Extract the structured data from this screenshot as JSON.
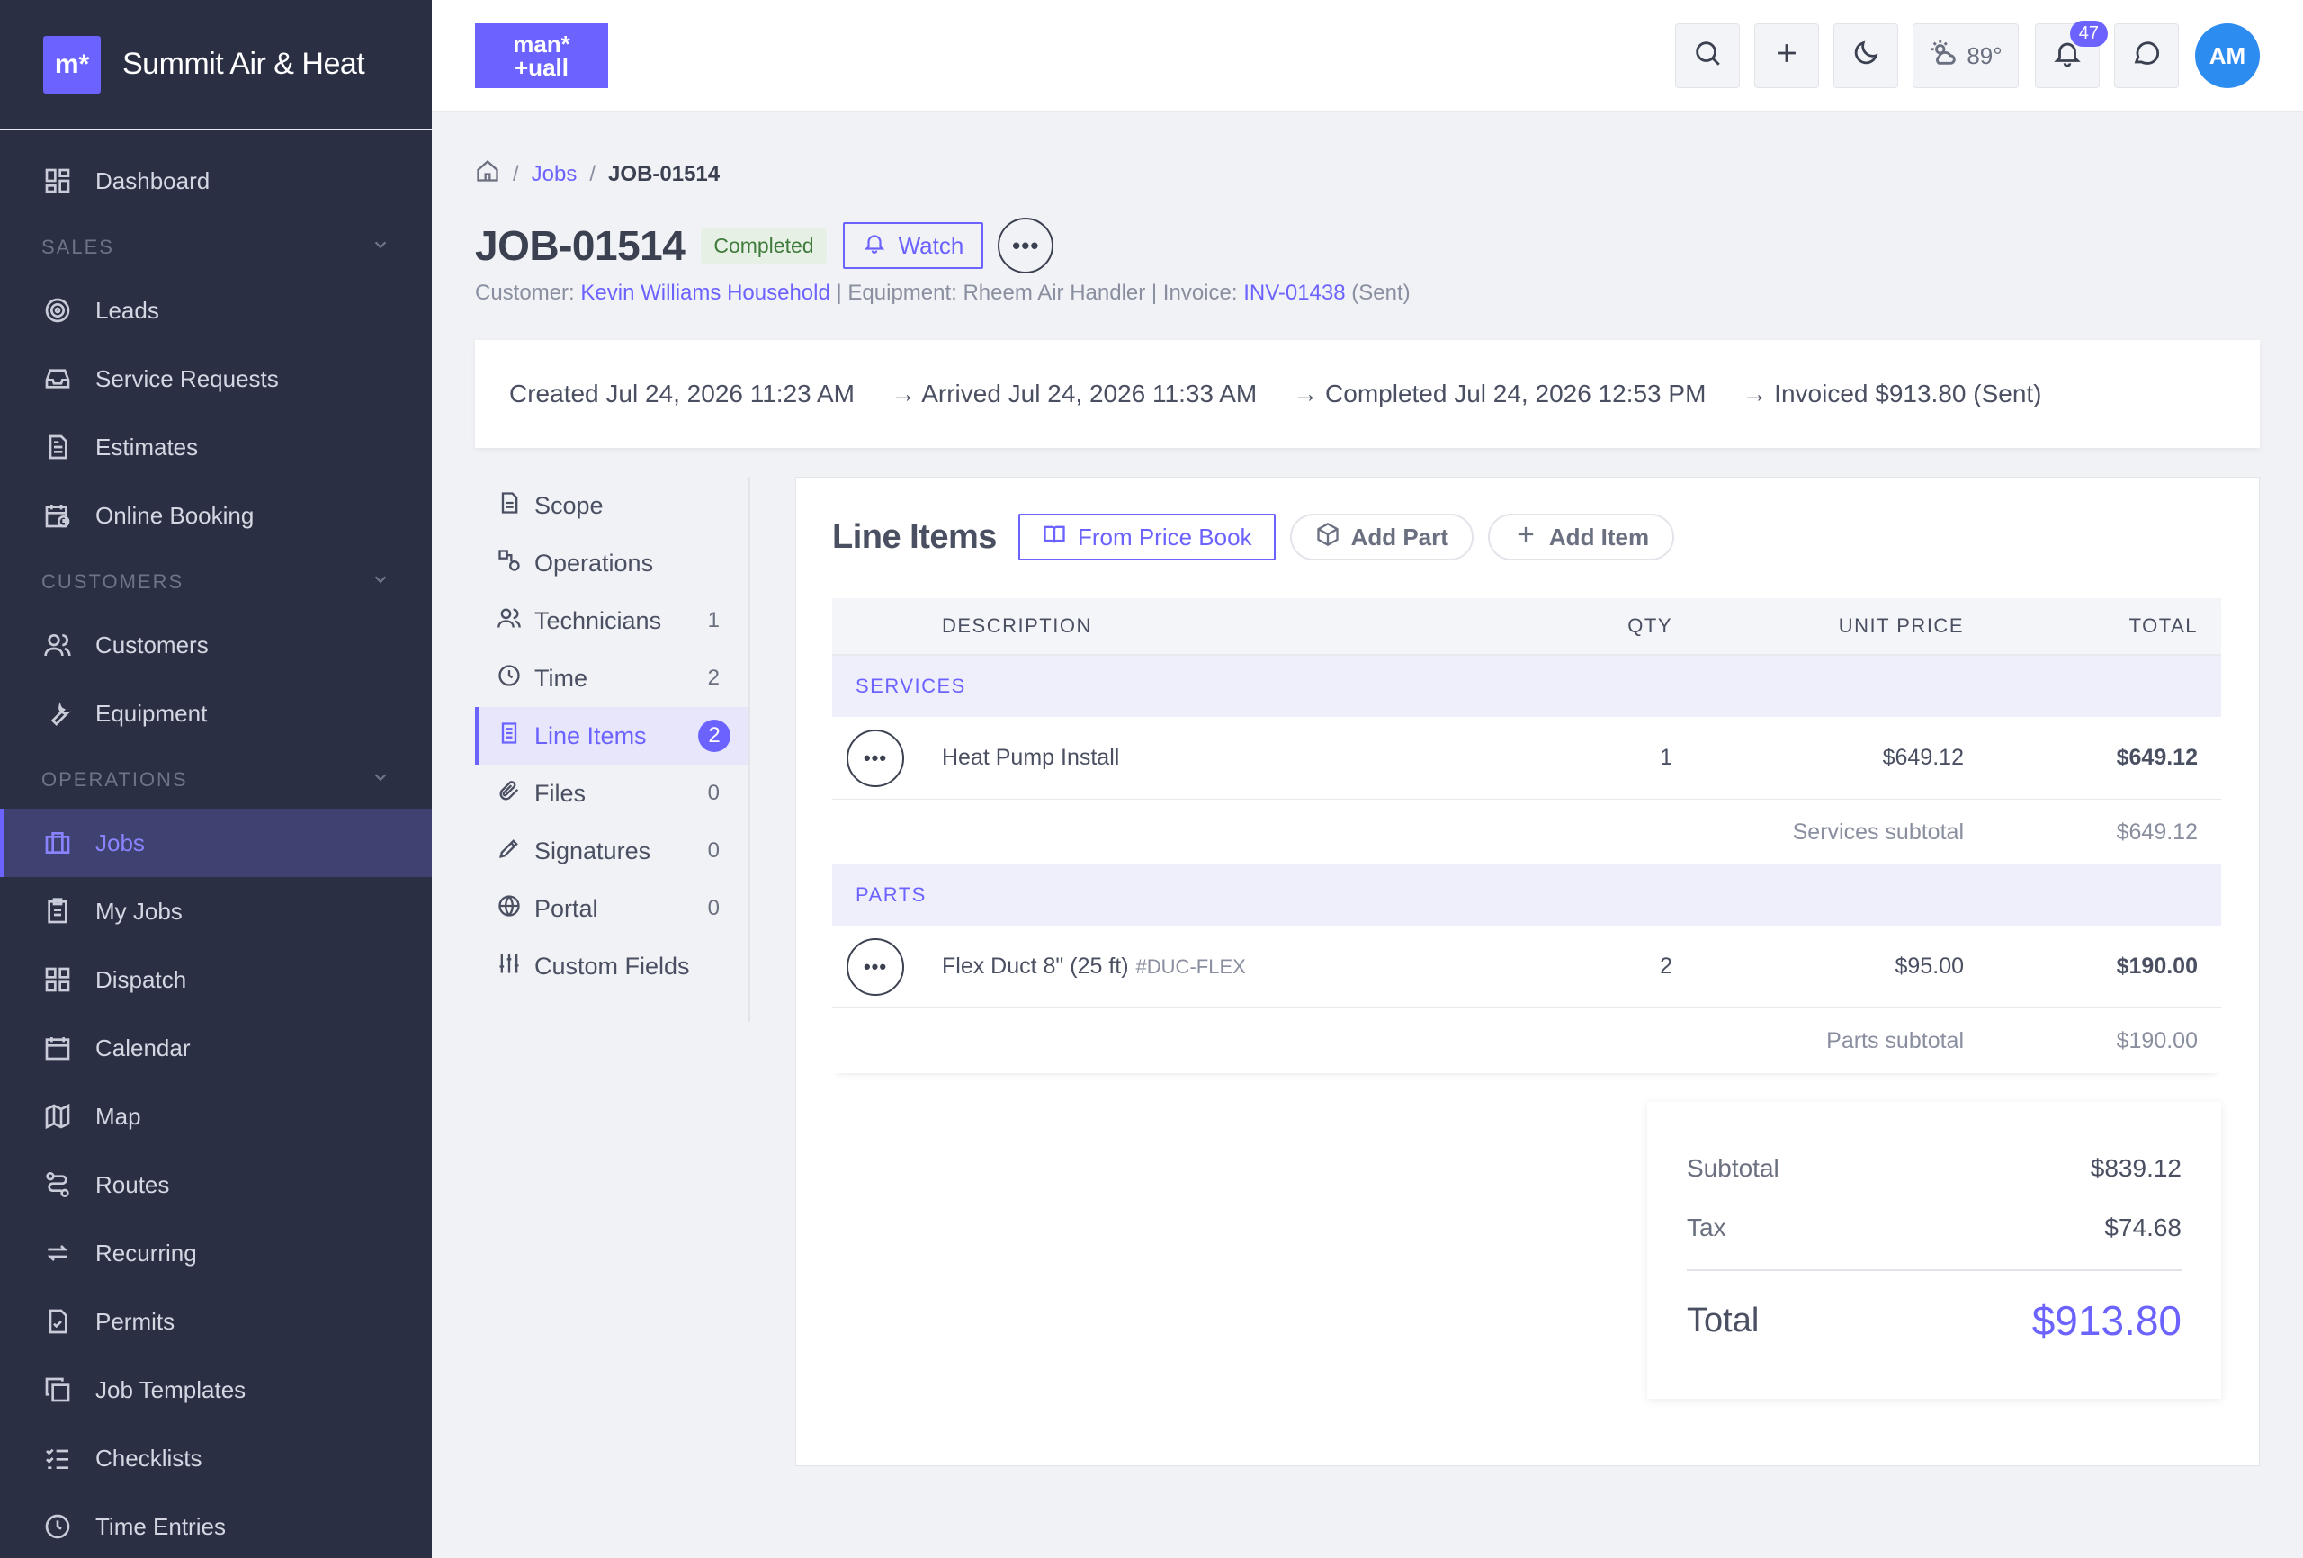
{
  "brand": {
    "logo": "m*",
    "name": "Summit Air & Heat"
  },
  "sidebar": {
    "top": [
      {
        "label": "Dashboard",
        "icon": "dashboard-icon"
      }
    ],
    "sales_label": "SALES",
    "sales": [
      {
        "label": "Leads",
        "icon": "target-icon"
      },
      {
        "label": "Service Requests",
        "icon": "inbox-icon"
      },
      {
        "label": "Estimates",
        "icon": "document-icon"
      },
      {
        "label": "Online Booking",
        "icon": "calendar-clock-icon"
      }
    ],
    "customers_label": "CUSTOMERS",
    "customers": [
      {
        "label": "Customers",
        "icon": "users-icon"
      },
      {
        "label": "Equipment",
        "icon": "wrench-icon"
      }
    ],
    "operations_label": "OPERATIONS",
    "operations": [
      {
        "label": "Jobs",
        "icon": "briefcase-icon",
        "active": true
      },
      {
        "label": "My Jobs",
        "icon": "clipboard-icon"
      },
      {
        "label": "Dispatch",
        "icon": "grid-icon"
      },
      {
        "label": "Calendar",
        "icon": "calendar-icon"
      },
      {
        "label": "Map",
        "icon": "map-icon"
      },
      {
        "label": "Routes",
        "icon": "route-icon"
      },
      {
        "label": "Recurring",
        "icon": "repeat-icon"
      },
      {
        "label": "Permits",
        "icon": "file-check-icon"
      },
      {
        "label": "Job Templates",
        "icon": "copy-icon"
      },
      {
        "label": "Checklists",
        "icon": "checklist-icon"
      },
      {
        "label": "Time Entries",
        "icon": "clock-icon"
      }
    ]
  },
  "topbar": {
    "logo_line1": "man*",
    "logo_line2": "+uall",
    "weather": "89°",
    "notifications": "47",
    "avatar": "AM"
  },
  "breadcrumb": {
    "jobs": "Jobs",
    "current": "JOB-01514",
    "sep": "/"
  },
  "job": {
    "title": "JOB-01514",
    "status": "Completed",
    "watch": "Watch",
    "meta": {
      "customer_label": "Customer:",
      "customer": "Kevin Williams Household",
      "equipment": "| Equipment: Rheem Air Handler | Invoice:",
      "invoice": "INV-01438",
      "invoice_status": "(Sent)"
    }
  },
  "timeline": [
    "Created Jul 24, 2026 11:23 AM",
    "→ Arrived Jul 24, 2026 11:33 AM",
    "→ Completed Jul 24, 2026 12:53 PM",
    "→ Invoiced $913.80 (Sent)"
  ],
  "subnav": [
    {
      "label": "Scope",
      "count": ""
    },
    {
      "label": "Operations",
      "count": ""
    },
    {
      "label": "Technicians",
      "count": "1"
    },
    {
      "label": "Time",
      "count": "2"
    },
    {
      "label": "Line Items",
      "count": "2",
      "active": true
    },
    {
      "label": "Files",
      "count": "0"
    },
    {
      "label": "Signatures",
      "count": "0"
    },
    {
      "label": "Portal",
      "count": "0"
    },
    {
      "label": "Custom Fields",
      "count": ""
    }
  ],
  "line_items": {
    "title": "Line Items",
    "from_price_book": "From Price Book",
    "add_part": "Add Part",
    "add_item": "Add Item",
    "columns": {
      "description": "DESCRIPTION",
      "qty": "QTY",
      "unit_price": "UNIT PRICE",
      "total": "TOTAL"
    },
    "services": {
      "label": "SERVICES",
      "rows": [
        {
          "description": "Heat Pump Install",
          "sku": "",
          "qty": "1",
          "unit_price": "$649.12",
          "total": "$649.12"
        }
      ],
      "subtotal_label": "Services subtotal",
      "subtotal": "$649.12"
    },
    "parts": {
      "label": "PARTS",
      "rows": [
        {
          "description": "Flex Duct 8\" (25 ft)",
          "sku": "#DUC-FLEX",
          "qty": "2",
          "unit_price": "$95.00",
          "total": "$190.00"
        }
      ],
      "subtotal_label": "Parts subtotal",
      "subtotal": "$190.00"
    }
  },
  "totals": {
    "subtotal_label": "Subtotal",
    "subtotal": "$839.12",
    "tax_label": "Tax",
    "tax": "$74.68",
    "total_label": "Total",
    "total": "$913.80"
  }
}
